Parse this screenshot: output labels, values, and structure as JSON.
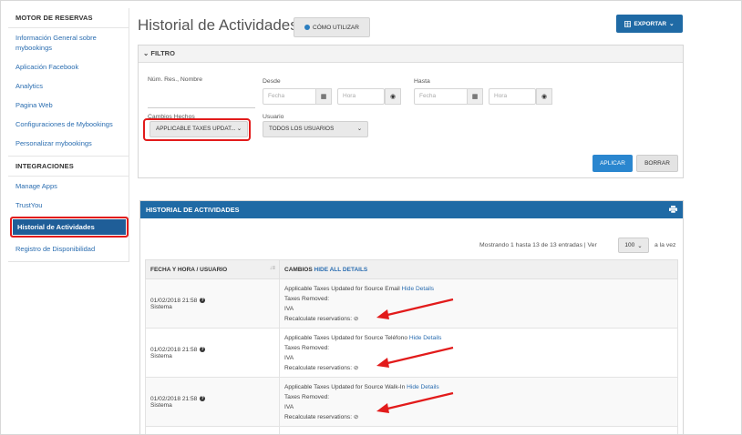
{
  "sidebar": {
    "section1_title": "MOTOR DE RESERVAS",
    "items1": [
      {
        "label": "Información General sobre mybookings"
      },
      {
        "label": "Aplicación Facebook"
      },
      {
        "label": "Analytics"
      },
      {
        "label": "Pagina Web"
      },
      {
        "label": "Configuraciones de Mybookings"
      },
      {
        "label": "Personalizar mybookings"
      }
    ],
    "section2_title": "INTEGRACIONES",
    "items2": [
      {
        "label": "Manage Apps"
      },
      {
        "label": "TrustYou"
      },
      {
        "label": "Historial de Actividades"
      },
      {
        "label": "Registro de Disponibilidad"
      }
    ]
  },
  "header": {
    "title": "Historial de Actividades",
    "help_button": "CÓMO UTILIZAR",
    "export_button": "EXPORTAR"
  },
  "filter": {
    "title": "FILTRO",
    "num_res_label": "Núm. Res., Nombre",
    "desde_label": "Desde",
    "hasta_label": "Hasta",
    "fecha_placeholder": "Fecha",
    "hora_placeholder": "Hora",
    "cambios_label": "Cambios Hechos",
    "cambios_value": "APPLICABLE TAXES UPDAT...",
    "usuario_label": "Usuario",
    "usuario_value": "TODOS LOS USUARIOS",
    "apply_button": "APLICAR",
    "clear_button": "BORRAR"
  },
  "history": {
    "title": "HISTORIAL DE ACTIVIDADES",
    "showing": "Mostrando 1 hasta 13 de 13 entradas | Ver",
    "per_page": "100",
    "per_page_suffix": "a la vez",
    "col_date": "FECHA Y HORA / USUARIO",
    "col_changes": "CAMBIOS",
    "hide_all": "HIDE ALL DETAILS",
    "rows": [
      {
        "date": "01/02/2018 21:58",
        "user": "Sistema",
        "change": "Applicable Taxes Updated for Source Email",
        "hide": "Hide Details",
        "removed": "Taxes Removed:",
        "tax": "IVA",
        "recalc": "Recalculate reservations: ⊘"
      },
      {
        "date": "01/02/2018 21:58",
        "user": "Sistema",
        "change": "Applicable Taxes Updated for Source Teléfono",
        "hide": "Hide Details",
        "removed": "Taxes Removed:",
        "tax": "IVA",
        "recalc": "Recalculate reservations: ⊘"
      },
      {
        "date": "01/02/2018 21:58",
        "user": "Sistema",
        "change": "Applicable Taxes Updated for Source Walk-In",
        "hide": "Hide Details",
        "removed": "Taxes Removed:",
        "tax": "IVA",
        "recalc": "Recalculate reservations: ⊘"
      }
    ]
  },
  "colors": {
    "accent": "#1f6aa5",
    "highlight": "#e21b1b",
    "link": "#2a6db0"
  }
}
